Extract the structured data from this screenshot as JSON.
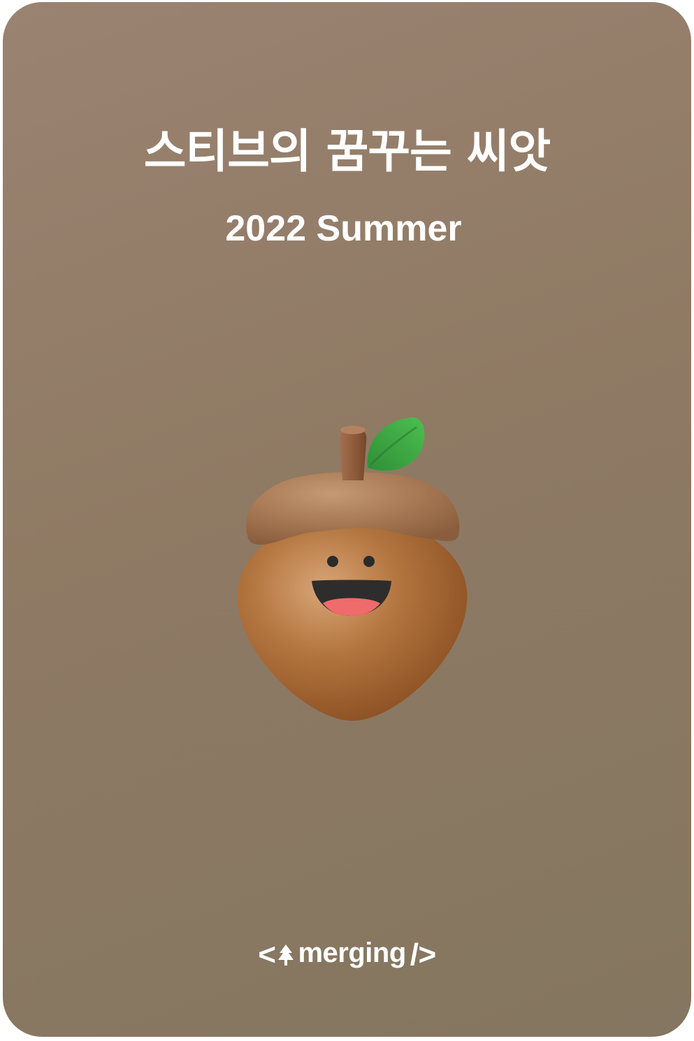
{
  "card": {
    "title": "스티브의 꿈꾸는 씨앗",
    "subtitle": "2022 Summer",
    "illustration": "acorn-character",
    "logo": {
      "open_bracket": "<",
      "icon": "tree-icon",
      "text": "merging",
      "close": "/>"
    }
  },
  "colors": {
    "background": "#91806b",
    "text": "#ffffff",
    "acorn_body": "#a9683a",
    "acorn_cap": "#a57851",
    "leaf": "#3aa53f"
  }
}
